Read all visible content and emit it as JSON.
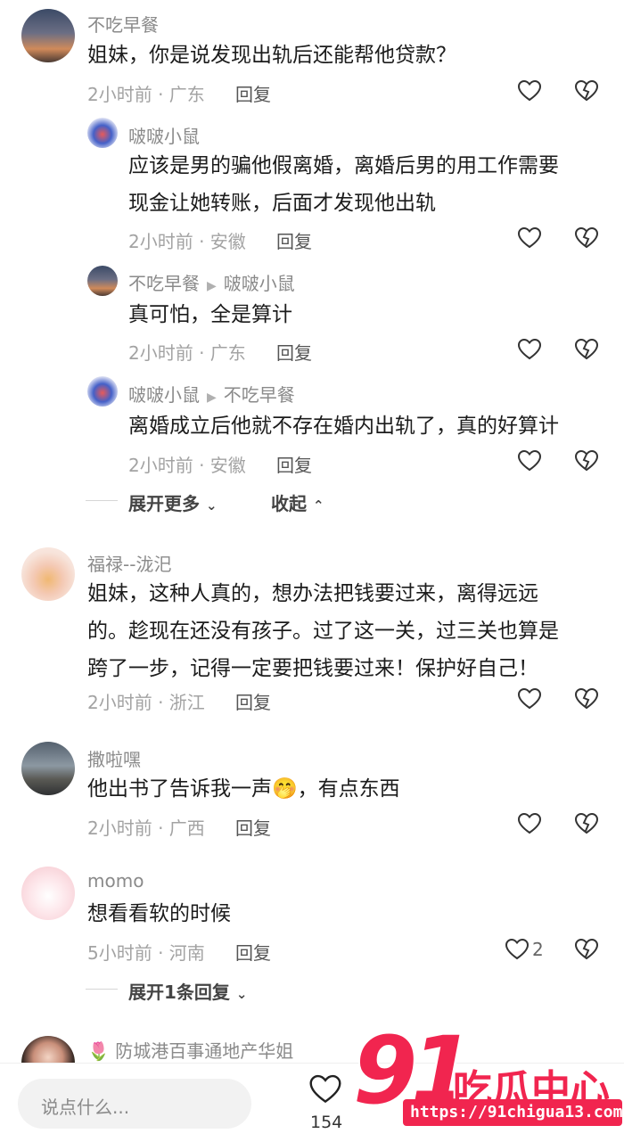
{
  "comments": [
    {
      "user": "不吃早餐",
      "text": [
        "姐妹，你是说发现出轨后还能帮他贷款？"
      ],
      "time": "2小时前 · 广东",
      "reply": "回复",
      "replies": [
        {
          "user": "啵啵小鼠",
          "text": [
            "应该是男的骗他假离婚，离婚后男的用工作需要",
            "现金让她转账，后面才发现他出轨"
          ],
          "time": "2小时前 · 安徽",
          "reply": "回复"
        },
        {
          "user": "不吃早餐",
          "to": "啵啵小鼠",
          "text": [
            "真可怕，全是算计"
          ],
          "time": "2小时前 · 广东",
          "reply": "回复"
        },
        {
          "user": "啵啵小鼠",
          "to": "不吃早餐",
          "text": [
            "离婚成立后他就不存在婚内出轨了，真的好算计"
          ],
          "time": "2小时前 · 安徽",
          "reply": "回复"
        }
      ],
      "expand_more": "展开更多",
      "collapse": "收起"
    },
    {
      "user": "福禄--泷汜",
      "text": [
        "姐妹，这种人真的，想办法把钱要过来，离得远远",
        "的。趁现在还没有孩子。过了这一关，过三关也算是",
        "跨了一步，记得一定要把钱要过来！保护好自己！"
      ],
      "time": "2小时前 · 浙江",
      "reply": "回复"
    },
    {
      "user": "撒啦嘿",
      "text_before": "他出书了告诉我一声",
      "emoji": "🤭",
      "text_after": "，有点东西",
      "time": "2小时前 · 广西",
      "reply": "回复"
    },
    {
      "user": "momo",
      "text": [
        "想看看软的时候"
      ],
      "time": "5小时前 · 河南",
      "reply": "回复",
      "likes": "2",
      "expand_replies": "展开1条回复"
    },
    {
      "user_prefix": "🌷",
      "user": "防城港百事通地产华姐"
    }
  ],
  "bottom": {
    "placeholder": "说点什么...",
    "like_count": "154"
  },
  "watermark": {
    "logo_num": "91",
    "logo_text": "吃瓜中心",
    "url": "https://91chigua13.com"
  }
}
